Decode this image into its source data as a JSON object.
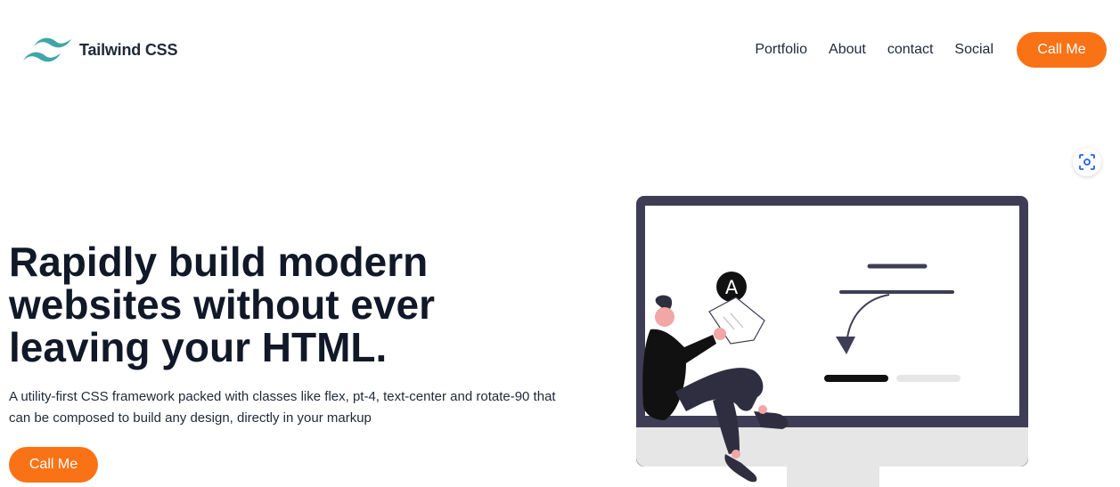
{
  "brand": {
    "name": "Tailwind CSS",
    "logo_icon": "tailwind-wave-logo",
    "logo_color": "#3fa6a6"
  },
  "nav": {
    "links": [
      "Portfolio",
      "About",
      "contact",
      "Social"
    ],
    "cta_label": "Call Me"
  },
  "hero": {
    "title_lines": [
      "Rapidly build modern",
      "websites without ever",
      "leaving your HTML."
    ],
    "subtitle": "A utility-first CSS framework packed with classes like flex, pt-4, text-center and rotate-90 that can be composed to build any design, directly in your markup",
    "cta_label": "Call Me"
  },
  "illustration": {
    "badge_letter": "A",
    "icon": "person-sitting-on-monitor"
  },
  "floating": {
    "icon": "screenshot-scan-icon"
  },
  "colors": {
    "accent": "#f97316",
    "text": "#111827",
    "monitor_frame": "#3f3d56"
  }
}
